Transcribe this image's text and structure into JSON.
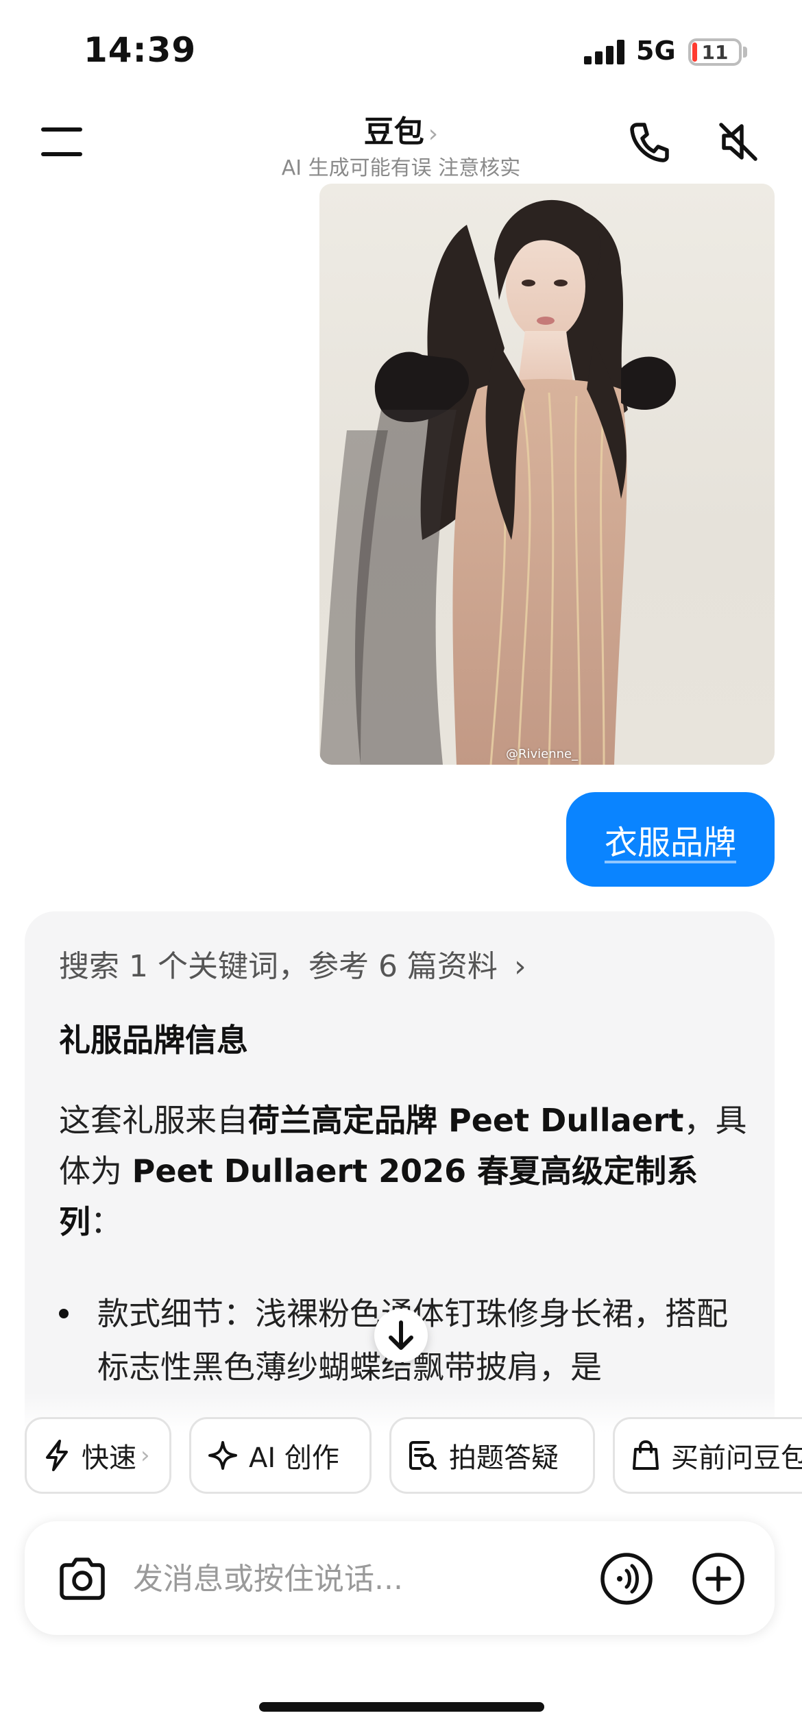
{
  "status_bar": {
    "time": "14:39",
    "network": "5G",
    "battery_level": "11",
    "battery_fraction": 0.11,
    "battery_color": "#ff3b30"
  },
  "header": {
    "title": "豆包",
    "title_chevron": "›",
    "subtitle": "AI 生成可能有误 注意核实",
    "menu_icon": "hamburger-menu-icon",
    "call_icon": "phone-icon",
    "mute_icon": "speaker-muted-icon"
  },
  "chat": {
    "image_watermark": "@Rivienne_",
    "user_message": "衣服品牌",
    "user_bubble_color": "#0a84ff",
    "answer": {
      "search_summary": "搜索 1 个关键词，参考 6 篇资料",
      "search_chevron": "›",
      "heading": "礼服品牌信息",
      "para_1": "这套礼服来自",
      "para_1_bold": "荷兰高定品牌 Peet Dullaert",
      "para_2": "，具体为 ",
      "para_2_bold": "Peet Dullaert 2026 春夏高级定制系列",
      "para_3": "：",
      "bullet_1": "款式细节：浅裸粉色通体钉珠修身长裙，搭配标志性黑色薄纱蝴蝶结飘带披肩，是"
    }
  },
  "quick_actions": [
    {
      "label": "快速",
      "icon": "lightning-icon",
      "chevron": "›"
    },
    {
      "label": "AI 创作",
      "icon": "sparkle-icon"
    },
    {
      "label": "拍题答疑",
      "icon": "photo-search-icon"
    },
    {
      "label": "买前问豆包",
      "icon": "shopping-bag-icon"
    }
  ],
  "input": {
    "placeholder": "发消息或按住说话...",
    "camera_icon": "camera-icon",
    "voice_icon": "voice-call-icon",
    "add_icon": "plus-circle-icon"
  }
}
